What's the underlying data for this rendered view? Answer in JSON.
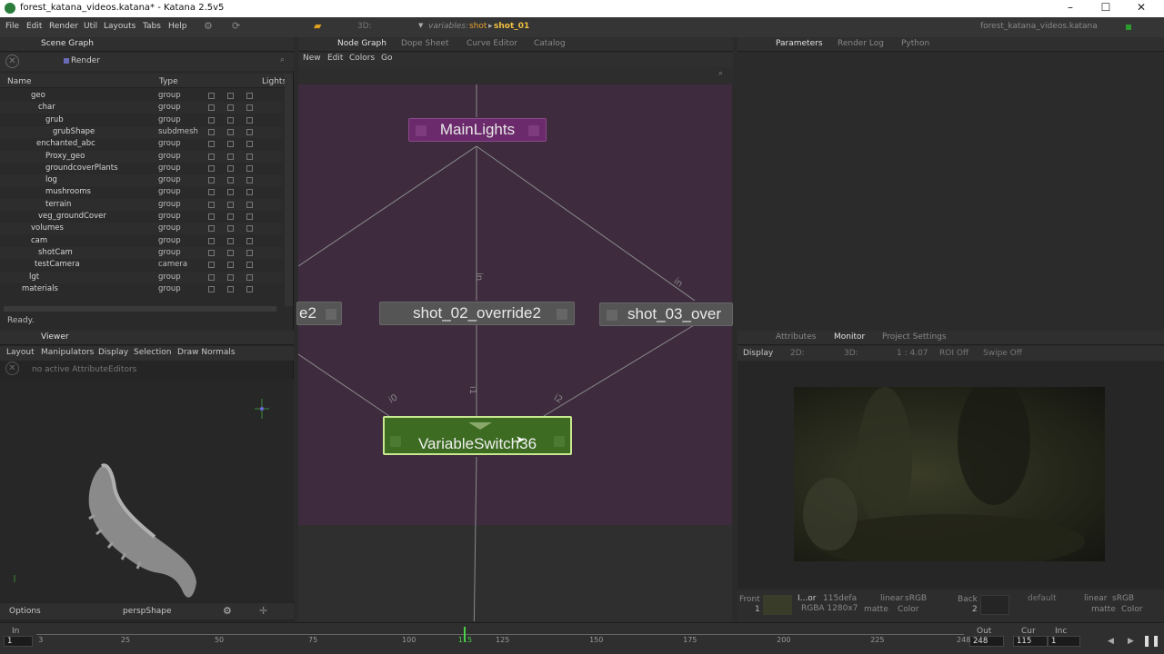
{
  "window": {
    "title": "forest_katana_videos.katana* - Katana 2.5v5",
    "minimize": "–",
    "maximize": "☐",
    "close": "✕"
  },
  "menubar": {
    "items": [
      "File",
      "Edit",
      "Render",
      "Util",
      "Layouts",
      "Tabs",
      "Help"
    ],
    "threeD": "3D:",
    "variables_label": "variables:",
    "variables_value": "shot",
    "variables_selected": "shot_01",
    "project": "forest_katana_videos.katana"
  },
  "scene_graph": {
    "tab": "Scene Graph",
    "render_label": "Render",
    "columns": {
      "name": "Name",
      "type": "Type",
      "lights": "Lights"
    },
    "rows": [
      {
        "name": "geo",
        "type": "group"
      },
      {
        "name": "char",
        "type": "group"
      },
      {
        "name": "grub",
        "type": "group"
      },
      {
        "name": "grubShape",
        "type": "subdmesh"
      },
      {
        "name": "enchanted_abc",
        "type": "group"
      },
      {
        "name": "Proxy_geo",
        "type": "group"
      },
      {
        "name": "groundcoverPlants",
        "type": "group"
      },
      {
        "name": "log",
        "type": "group"
      },
      {
        "name": "mushrooms",
        "type": "group"
      },
      {
        "name": "terrain",
        "type": "group"
      },
      {
        "name": "veg_groundCover",
        "type": "group"
      },
      {
        "name": "volumes",
        "type": "group"
      },
      {
        "name": "cam",
        "type": "group"
      },
      {
        "name": "shotCam",
        "type": "group"
      },
      {
        "name": "testCamera",
        "type": "camera"
      },
      {
        "name": "lgt",
        "type": "group"
      },
      {
        "name": "materials",
        "type": "group"
      }
    ],
    "status": "Ready."
  },
  "viewer": {
    "tab": "Viewer",
    "menu": [
      "Layout",
      "Manipulators",
      "Display",
      "Selection",
      "Draw Normals"
    ],
    "attr_editors": "no active AttributeEditors",
    "options": "Options",
    "camera": "perspShape"
  },
  "node_graph": {
    "tabs": [
      "Node Graph",
      "Dope Sheet",
      "Curve Editor",
      "Catalog"
    ],
    "menu": [
      "New",
      "Edit",
      "Colors",
      "Go"
    ],
    "nodes": {
      "main_lights": "MainLights",
      "shot01": "e2",
      "shot02": "shot_02_override2",
      "shot03": "shot_03_over",
      "switch": "VariableSwitch36"
    },
    "ports": {
      "i0": "i0",
      "i1": "i1",
      "i2": "i2",
      "in": "in",
      "in2": "in"
    }
  },
  "parameters": {
    "tabs": [
      "Parameters",
      "Render Log",
      "Python"
    ]
  },
  "monitor": {
    "tabs": [
      "Attributes",
      "Monitor",
      "Project Settings"
    ],
    "toolbar": {
      "display": "Display",
      "twoD": "2D:",
      "threeD": "3D:",
      "ratio": "1 : 4.07",
      "roi": "ROI Off",
      "swipe": "Swipe Off"
    },
    "front": "Front",
    "front_num": "1",
    "info1": "I...or",
    "info2": "115defa",
    "info3": "RGBA 1280x7",
    "linear1": "linear",
    "srgb1": "sRGB",
    "matte1": "matte",
    "color1": "Color",
    "back": "Back",
    "back_num": "2",
    "default": "default",
    "linear2": "linear",
    "srgb2": "sRGB",
    "matte2": "matte",
    "color2": "Color"
  },
  "timeline": {
    "in_label": "In",
    "in_value": "1",
    "out_label": "Out",
    "out_value": "248",
    "cur_label": "Cur",
    "cur_value": "115",
    "inc_label": "Inc",
    "inc_value": "1",
    "ticks": [
      "3",
      "25",
      "50",
      "75",
      "100",
      "115",
      "125",
      "150",
      "175",
      "200",
      "225",
      "248"
    ],
    "current": 115,
    "start": 1,
    "end": 248
  }
}
